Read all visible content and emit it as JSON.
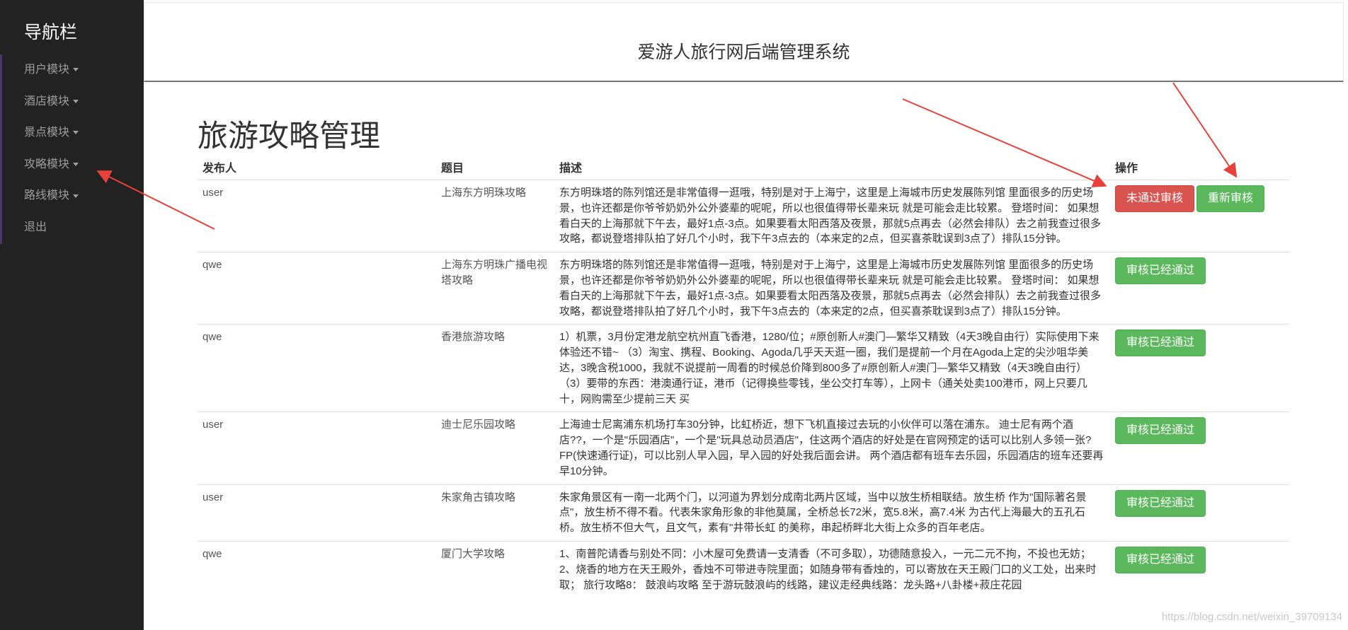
{
  "sidebar": {
    "title": "导航栏",
    "items": [
      {
        "label": "用户模块",
        "has_caret": true
      },
      {
        "label": "酒店模块",
        "has_caret": true
      },
      {
        "label": "景点模块",
        "has_caret": true
      },
      {
        "label": "攻略模块",
        "has_caret": true
      },
      {
        "label": "路线模块",
        "has_caret": true
      },
      {
        "label": "退出",
        "has_caret": false
      }
    ]
  },
  "header": {
    "system_title": "爱游人旅行网后端管理系统"
  },
  "page": {
    "title": "旅游攻略管理"
  },
  "table": {
    "columns": [
      "发布人",
      "题目",
      "描述",
      "操作"
    ],
    "rows": [
      {
        "publisher": "user",
        "title": "上海东方明珠攻略",
        "description": "东方明珠塔的陈列馆还是非常值得一逛哦，特别是对于上海宁，这里是上海城市历史发展陈列馆 里面很多的历史场景，也许还都是你爷爷奶奶外公外婆辈的呢呢，所以也很值得带长辈来玩 就是可能会走比较累。        登塔时间：        如果想看白天的上海那就下午去，最好1点-3点。如果要看太阳西落及夜景，那就5点再去（必然会排队）去之前我查过很多攻略，都说登塔排队拍了好几个小时，我下午3点去的（本来定的2点，但买喜茶耽误到3点了）排队15分钟。",
        "actions": [
          {
            "label": "未通过审核",
            "style": "danger"
          },
          {
            "label": "重新审核",
            "style": "success"
          }
        ]
      },
      {
        "publisher": "qwe",
        "title": "上海东方明珠广播电视塔攻略",
        "description": "    东方明珠塔的陈列馆还是非常值得一逛哦，特别是对于上海宁，这里是上海城市历史发展陈列馆 里面很多的历史场景，也许还都是你爷爷奶奶外公外婆辈的呢呢，所以也很值得带长辈来玩 就是可能会走比较累。        登塔时间：        如果想看白天的上海那就下午去，最好1点-3点。如果要看太阳西落及夜景，那就5点再去（必然会排队）去之前我查过很多攻略，都说登塔排队拍了好几个小时，我下午3点去的（本来定的2点，但买喜茶耽误到3点了）排队15分钟。",
        "actions": [
          {
            "label": "审核已经通过",
            "style": "success"
          }
        ]
      },
      {
        "publisher": "qwe",
        "title": "香港旅游攻略",
        "description": "1）机票，3月份定港龙航空杭州直飞香港，1280/位；#原创新人#澳门—繁华又精致（4天3晚自由行）实际使用下来体验还不错~        （3）淘宝、携程、Booking、Agoda几乎天天逛一圈，我们是提前一个月在Agoda上定的尖沙咀华美达，3晚含税1000，我就不说提前一周看的时候总价降到800多了#原创新人#澳门—繁华又精致（4天3晚自由行）        （3）要带的东西：港澳通行证，港币（记得换些零钱，坐公交打车等），上网卡（通关处卖100港币，网上只要几十，网购需至少提前三天      买",
        "actions": [
          {
            "label": "审核已经通过",
            "style": "success"
          }
        ]
      },
      {
        "publisher": "user",
        "title": "迪士尼乐园攻略",
        "description": "上海迪士尼离浦东机场打车30分钟，比虹桥近，想下飞机直接过去玩的小伙伴可以落在浦东。        迪士尼有两个酒店??，一个是\"乐园酒店\"，一个是\"玩具总动员酒店\"，住这两个酒店的好处是在官网预定的话可以比别人多领一张?FP(快速通行证)，可以比别人早入园，早入园的好处我后面会讲。        两个酒店都有班车去乐园，乐园酒店的班车还要再早10分钟。",
        "actions": [
          {
            "label": "审核已经通过",
            "style": "success"
          }
        ]
      },
      {
        "publisher": "user",
        "title": "朱家角古镇攻略",
        "description": "        朱家角景区有一南一北两个门，以河道为界划分成南北两片区域，当中以放生桥相联结。放生桥        作为\"国际著名景点\"，放生桥不得不看。代表朱家角形象的非他莫属，全桥总长72米，宽5.8米，高7.4米 为古代上海最大的五孔石桥。放生桥不但大气，且文气，素有\"井带长虹 的美称，串起桥畔北大街上众多的百年老店。",
        "actions": [
          {
            "label": "审核已经通过",
            "style": "success"
          }
        ]
      },
      {
        "publisher": "qwe",
        "title": "厦门大学攻略",
        "description": "1、南普陀请香与别处不同：小木屋可免费请一支清香（不可多取），功德随意投入，一元二元不拘，不投也无妨；        2、烧香的地方在天王殿外，香烛不可带进寺院里面；如随身带有香烛的，可以寄放在天王殿门口的义工处，出来时取；  旅行攻略8： 鼓浪屿攻略 至于游玩鼓浪屿的线路，建议走经典线路：龙头路+八卦楼+菽庄花园",
        "actions": [
          {
            "label": "审核已经通过",
            "style": "success"
          }
        ]
      }
    ]
  },
  "watermark": "https://blog.csdn.net/weixin_39709134",
  "colors": {
    "sidebar_bg": "#222222",
    "danger": "#d9534f",
    "success": "#5cb85c",
    "arrow": "#e8413b"
  }
}
